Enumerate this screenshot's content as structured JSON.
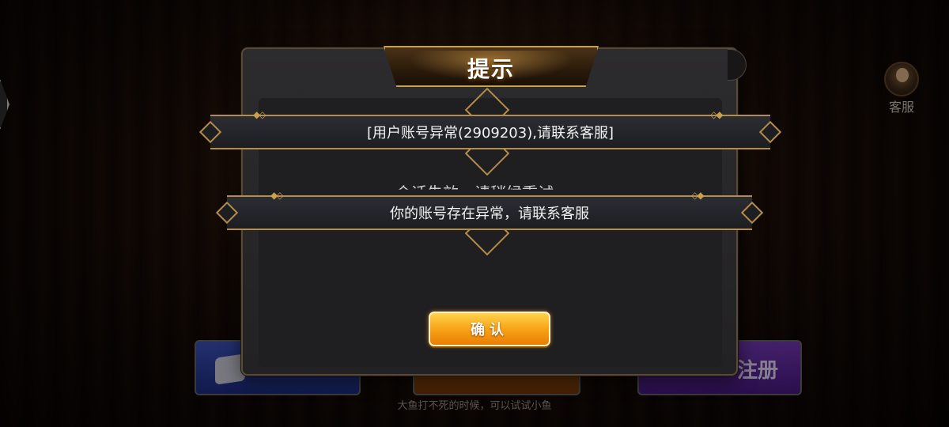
{
  "background": {
    "service_label": "客服",
    "register_label": "注册",
    "hint_text": "大鱼打不死的时候，可以试试小鱼"
  },
  "dialog": {
    "title": "提示",
    "message_1": "[用户账号异常(2909203),请联系客服]",
    "message_hidden": "会话失效，请稍候重试",
    "message_2": "你的账号存在异常，请联系客服",
    "confirm_label": "确认"
  },
  "colors": {
    "gold_border": "#b58d4a",
    "button_orange": "#f7a416",
    "panel": "#2c2b2d"
  },
  "icons": [
    "dice-icon",
    "avatar-icon",
    "diamond-ornament-icon"
  ]
}
